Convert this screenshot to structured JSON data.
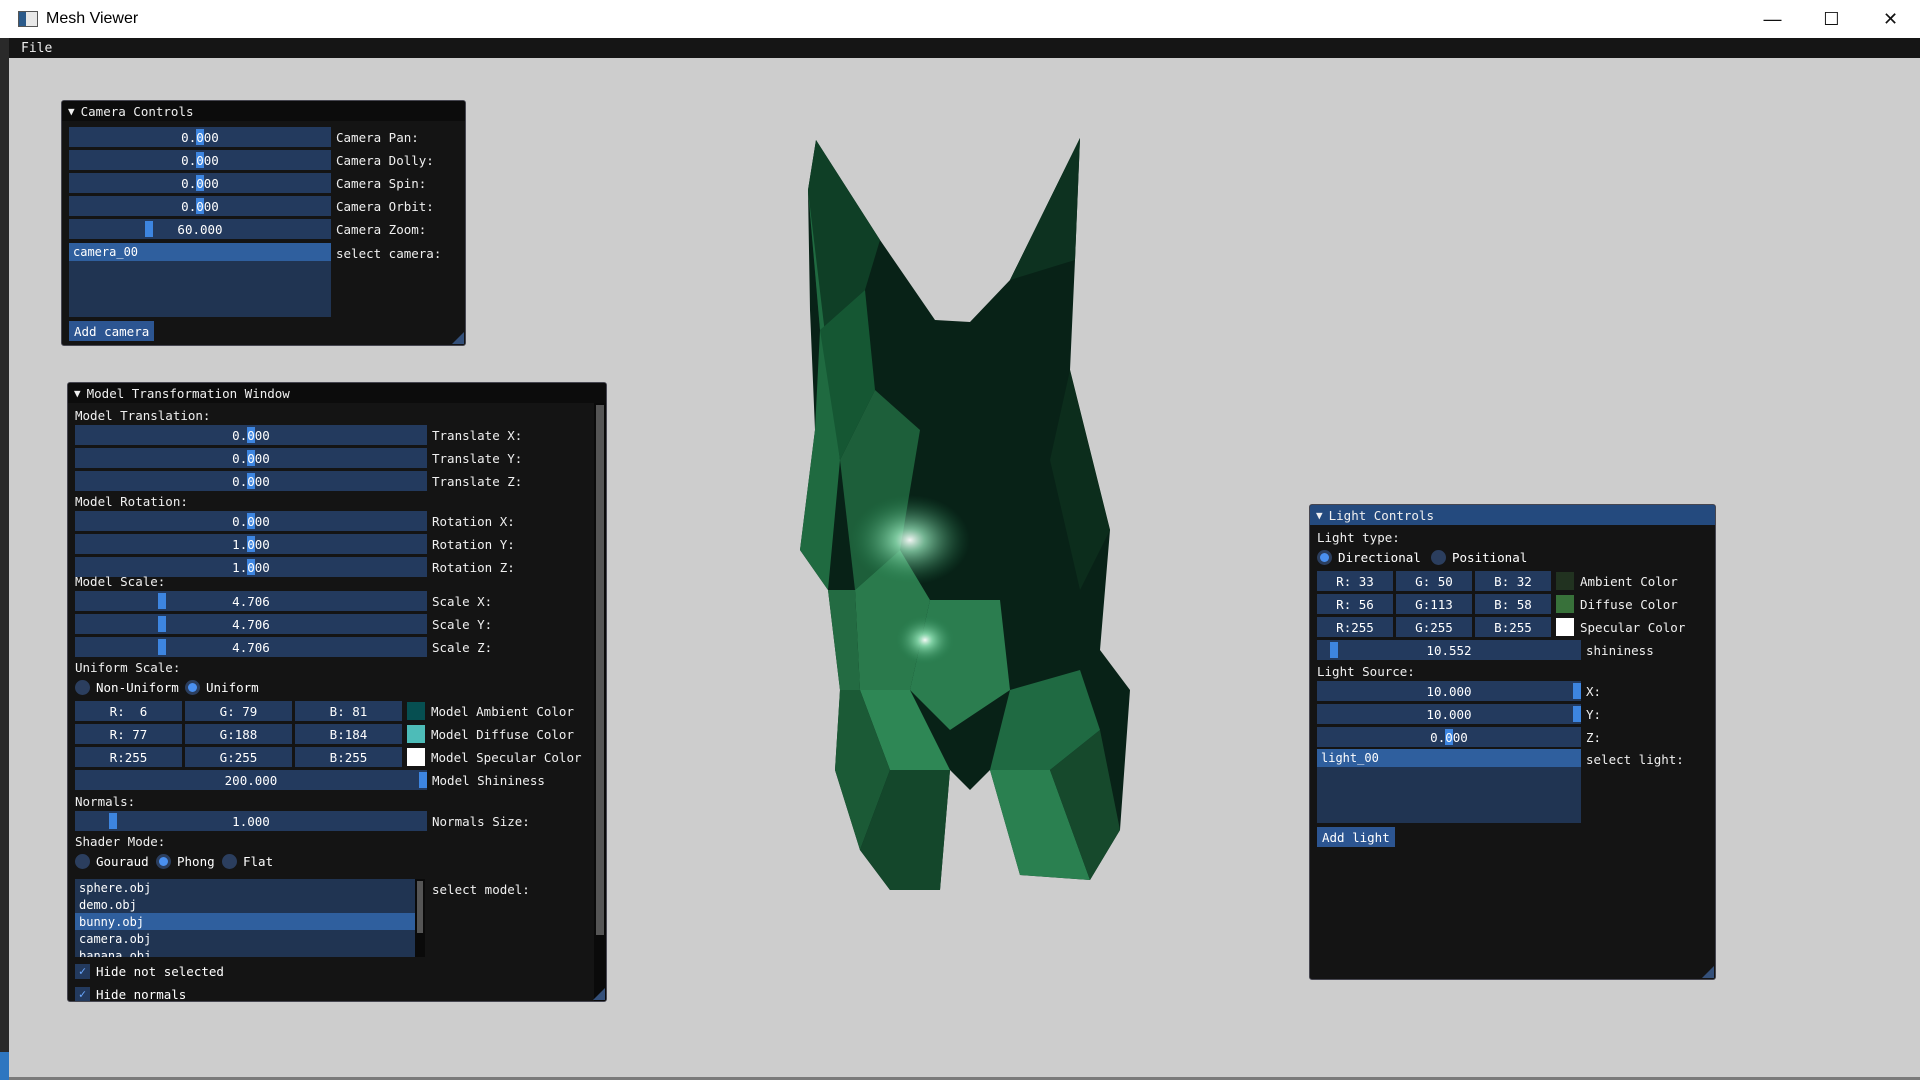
{
  "window": {
    "title": "Mesh Viewer",
    "minimize": "—",
    "maximize": "☐",
    "close": "✕"
  },
  "menu": {
    "file": "File"
  },
  "camera": {
    "title": "Camera Controls",
    "sliders": [
      {
        "value": "0.000",
        "label": "Camera Pan:",
        "level": 0.5
      },
      {
        "value": "0.000",
        "label": "Camera Dolly:",
        "level": 0.5
      },
      {
        "value": "0.000",
        "label": "Camera Spin:",
        "level": 0.5
      },
      {
        "value": "0.000",
        "label": "Camera Orbit:",
        "level": 0.5
      },
      {
        "value": "60.000",
        "label": "Camera Zoom:",
        "level": 0.3
      }
    ],
    "list_items": [
      "camera_00"
    ],
    "select_label": "select camera:",
    "add_button": "Add camera"
  },
  "model": {
    "title": "Model Transformation Window",
    "translation_header": "Model Translation:",
    "translation": [
      {
        "value": "0.000",
        "label": "Translate X:",
        "level": 0.5
      },
      {
        "value": "0.000",
        "label": "Translate Y:",
        "level": 0.5
      },
      {
        "value": "0.000",
        "label": "Translate Z:",
        "level": 0.5
      }
    ],
    "rotation_header": "Model Rotation:",
    "rotation": [
      {
        "value": "0.000",
        "label": "Rotation X:",
        "level": 0.5
      },
      {
        "value": "1.000",
        "label": "Rotation Y:",
        "level": 0.5
      },
      {
        "value": "1.000",
        "label": "Rotation Z:",
        "level": 0.5
      }
    ],
    "scale_header": "Model Scale:",
    "scale": [
      {
        "value": "4.706",
        "label": "Scale X:",
        "level": 0.24
      },
      {
        "value": "4.706",
        "label": "Scale Y:",
        "level": 0.24
      },
      {
        "value": "4.706",
        "label": "Scale Z:",
        "level": 0.24
      }
    ],
    "uniform_header": "Uniform Scale:",
    "uniform_options": [
      "Non-Uniform",
      "Uniform"
    ],
    "uniform_selected": 1,
    "colors": [
      {
        "r": "R:  6",
        "g": "G: 79",
        "b": "B: 81",
        "label": "Model Ambient Color",
        "swatch": "#064f51"
      },
      {
        "r": "R: 77",
        "g": "G:188",
        "b": "B:184",
        "label": "Model Diffuse Color",
        "swatch": "#4dbcb8"
      },
      {
        "r": "R:255",
        "g": "G:255",
        "b": "B:255",
        "label": "Model Specular Color",
        "swatch": "#ffffff"
      }
    ],
    "shininess": {
      "value": "200.000",
      "label": "Model Shininess",
      "level": 1.0
    },
    "normals_header": "Normals:",
    "normals": {
      "value": "1.000",
      "label": "Normals Size:",
      "level": 0.1
    },
    "shader_header": "Shader Mode:",
    "shader_options": [
      "Gouraud",
      "Phong",
      "Flat"
    ],
    "shader_selected": 1,
    "models": [
      "sphere.obj",
      "demo.obj",
      "bunny.obj",
      "camera.obj",
      "banana.obj"
    ],
    "model_selected": 2,
    "select_label": "select model:",
    "checkboxes": [
      {
        "label": "Hide not selected",
        "checked": true
      },
      {
        "label": "Hide normals",
        "checked": true
      }
    ]
  },
  "light": {
    "title": "Light Controls",
    "type_header": "Light type:",
    "type_options": [
      "Directional",
      "Positional"
    ],
    "type_selected": 0,
    "colors": [
      {
        "r": "R: 33",
        "g": "G: 50",
        "b": "B: 32",
        "label": "Ambient Color",
        "swatch": "#213220"
      },
      {
        "r": "R: 56",
        "g": "G:113",
        "b": "B: 58",
        "label": "Diffuse Color",
        "swatch": "#38713a"
      },
      {
        "r": "R:255",
        "g": "G:255",
        "b": "B:255",
        "label": "Specular Color",
        "swatch": "#ffffff"
      }
    ],
    "shininess": {
      "value": "10.552",
      "label": "shininess",
      "level": 0.05
    },
    "source_header": "Light Source:",
    "source": [
      {
        "value": "10.000",
        "label": "X:",
        "level": 1.0
      },
      {
        "value": "10.000",
        "label": "Y:",
        "level": 1.0
      },
      {
        "value": "0.000",
        "label": "Z:",
        "level": 0.5
      }
    ],
    "list_items": [
      "light_00"
    ],
    "select_label": "select light:",
    "add_button": "Add light"
  },
  "colors": {
    "accent": "#3d85e0",
    "frame_bg": "#233a5e",
    "window_bg": "#141414",
    "viewport_bg": "#cdcdcd",
    "mesh_dark": "#082217",
    "mesh_light": "#2f8a5a"
  }
}
